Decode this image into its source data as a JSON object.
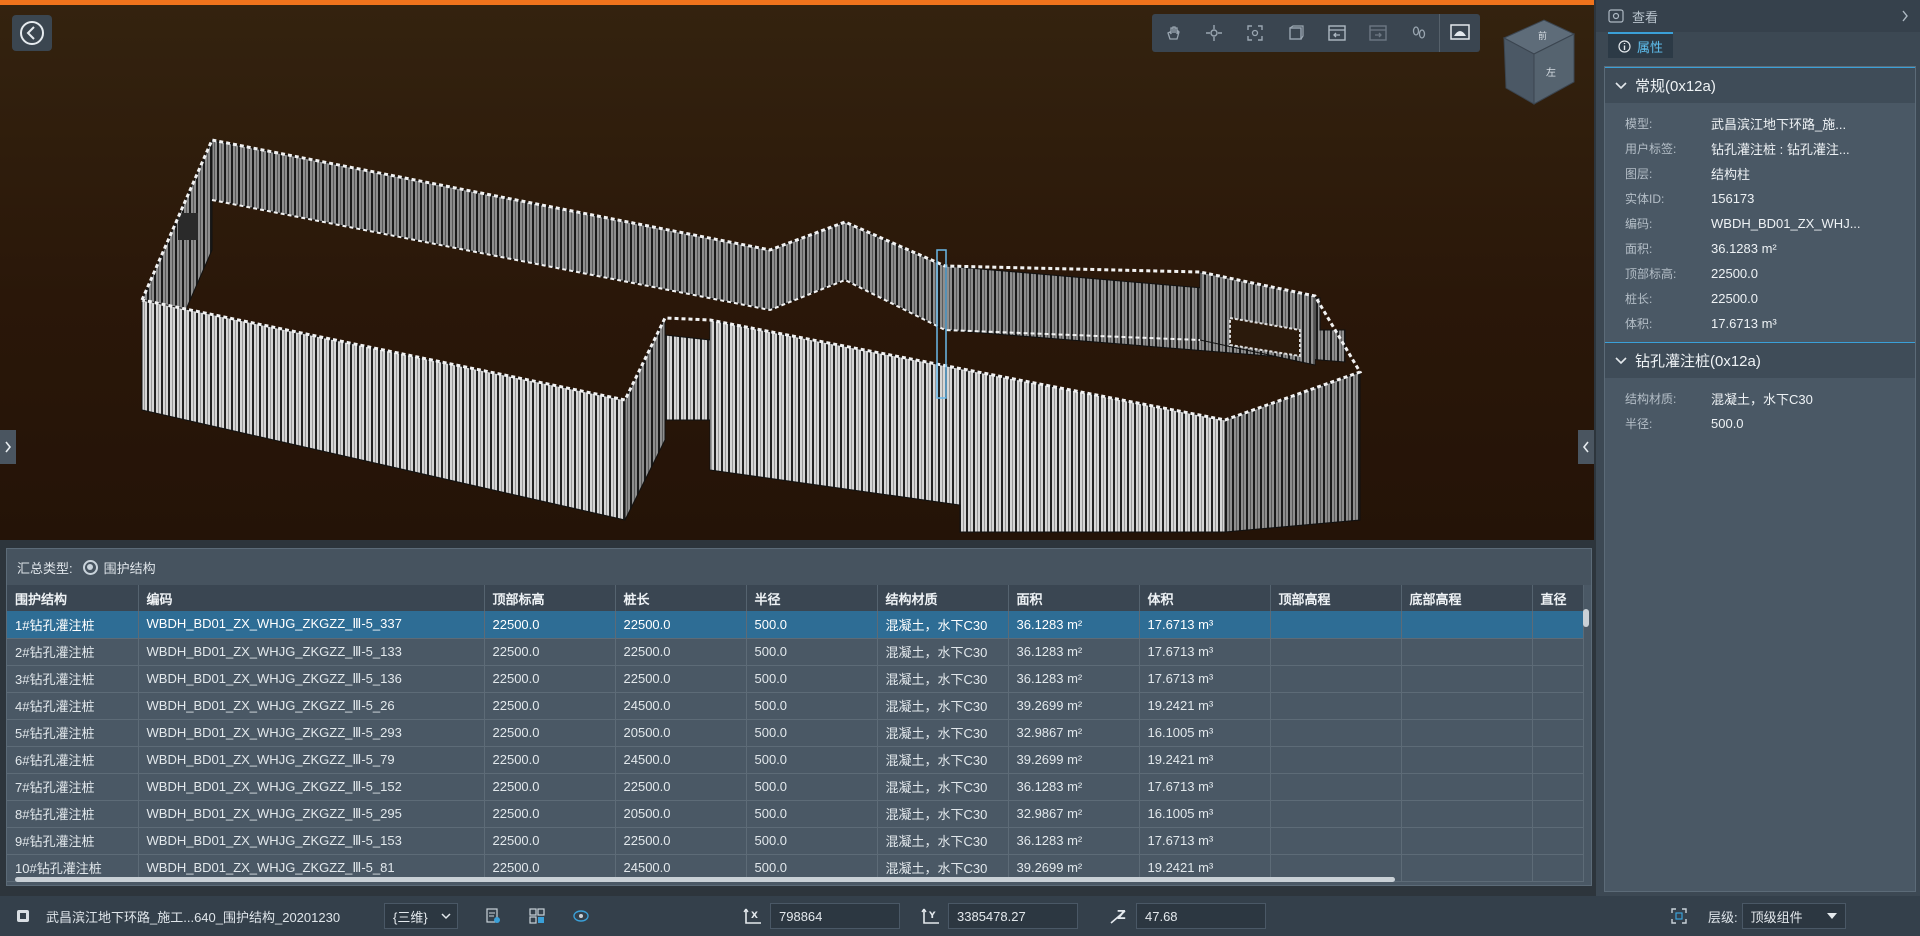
{
  "toolbar": {
    "icons": [
      "pan-icon",
      "orbit-icon",
      "fit-view-icon",
      "section-box-icon",
      "walk-icon",
      "measure-icon",
      "footprint-icon",
      "render-mode-icon"
    ]
  },
  "navcube": {
    "top_label": "前",
    "face_label": "左"
  },
  "summary": {
    "type_label": "汇总类型:",
    "radio_label": "围护结构",
    "columns": [
      "围护结构",
      "编码",
      "顶部标高",
      "桩长",
      "半径",
      "结构材质",
      "面积",
      "体积",
      "顶部高程",
      "底部高程",
      "直径"
    ],
    "rows": [
      [
        "1#钻孔灌注桩",
        "WBDH_BD01_ZX_WHJG_ZKGZZ_Ⅲ-5_337",
        "22500.0",
        "22500.0",
        "500.0",
        "混凝土，水下C30",
        "36.1283 m²",
        "17.6713 m³",
        "",
        "",
        ""
      ],
      [
        "2#钻孔灌注桩",
        "WBDH_BD01_ZX_WHJG_ZKGZZ_Ⅲ-5_133",
        "22500.0",
        "22500.0",
        "500.0",
        "混凝土，水下C30",
        "36.1283 m²",
        "17.6713 m³",
        "",
        "",
        ""
      ],
      [
        "3#钻孔灌注桩",
        "WBDH_BD01_ZX_WHJG_ZKGZZ_Ⅲ-5_136",
        "22500.0",
        "22500.0",
        "500.0",
        "混凝土，水下C30",
        "36.1283 m²",
        "17.6713 m³",
        "",
        "",
        ""
      ],
      [
        "4#钻孔灌注桩",
        "WBDH_BD01_ZX_WHJG_ZKGZZ_Ⅲ-5_26",
        "22500.0",
        "24500.0",
        "500.0",
        "混凝土，水下C30",
        "39.2699 m²",
        "19.2421 m³",
        "",
        "",
        ""
      ],
      [
        "5#钻孔灌注桩",
        "WBDH_BD01_ZX_WHJG_ZKGZZ_Ⅲ-5_293",
        "22500.0",
        "20500.0",
        "500.0",
        "混凝土，水下C30",
        "32.9867 m²",
        "16.1005 m³",
        "",
        "",
        ""
      ],
      [
        "6#钻孔灌注桩",
        "WBDH_BD01_ZX_WHJG_ZKGZZ_Ⅲ-5_79",
        "22500.0",
        "24500.0",
        "500.0",
        "混凝土，水下C30",
        "39.2699 m²",
        "19.2421 m³",
        "",
        "",
        ""
      ],
      [
        "7#钻孔灌注桩",
        "WBDH_BD01_ZX_WHJG_ZKGZZ_Ⅲ-5_152",
        "22500.0",
        "22500.0",
        "500.0",
        "混凝土，水下C30",
        "36.1283 m²",
        "17.6713 m³",
        "",
        "",
        ""
      ],
      [
        "8#钻孔灌注桩",
        "WBDH_BD01_ZX_WHJG_ZKGZZ_Ⅲ-5_295",
        "22500.0",
        "20500.0",
        "500.0",
        "混凝土，水下C30",
        "32.9867 m²",
        "16.1005 m³",
        "",
        "",
        ""
      ],
      [
        "9#钻孔灌注桩",
        "WBDH_BD01_ZX_WHJG_ZKGZZ_Ⅲ-5_153",
        "22500.0",
        "22500.0",
        "500.0",
        "混凝土，水下C30",
        "36.1283 m²",
        "17.6713 m³",
        "",
        "",
        ""
      ],
      [
        "10#钻孔灌注桩",
        "WBDH_BD01_ZX_WHJG_ZKGZZ_Ⅲ-5_81",
        "22500.0",
        "24500.0",
        "500.0",
        "混凝土，水下C30",
        "39.2699 m²",
        "19.2421 m³",
        "",
        "",
        ""
      ]
    ]
  },
  "panel": {
    "tab_view": "查看",
    "tab_attr": "属性",
    "group1_title": "常规(0x12a)",
    "group1_props": [
      {
        "k": "模型:",
        "v": "武昌滨江地下环路_施..."
      },
      {
        "k": "用户标签:",
        "v": "钻孔灌注桩 : 钻孔灌注..."
      },
      {
        "k": "图层:",
        "v": "结构柱"
      },
      {
        "k": "实体ID:",
        "v": "156173"
      },
      {
        "k": "编码:",
        "v": "WBDH_BD01_ZX_WHJ..."
      },
      {
        "k": "面积:",
        "v": "36.1283 m²"
      },
      {
        "k": "顶部标高:",
        "v": "22500.0"
      },
      {
        "k": "桩长:",
        "v": "22500.0"
      },
      {
        "k": "体积:",
        "v": "17.6713 m³"
      }
    ],
    "group2_title": "钻孔灌注桩(0x12a)",
    "group2_props": [
      {
        "k": "结构材质:",
        "v": "混凝土，水下C30"
      },
      {
        "k": "半径:",
        "v": "500.0"
      }
    ]
  },
  "status": {
    "model_name": "武昌滨江地下环路_施工...640_围护结构_20201230",
    "view_mode": "{三维}",
    "x": "798864",
    "y": "3385478.27",
    "z": "47.68",
    "level_label": "层级:",
    "level_value": "顶级组件"
  },
  "colors": {
    "accent": "#f0731c",
    "selected_row": "#2e6d95",
    "tab_active": "#3aa0d8"
  }
}
